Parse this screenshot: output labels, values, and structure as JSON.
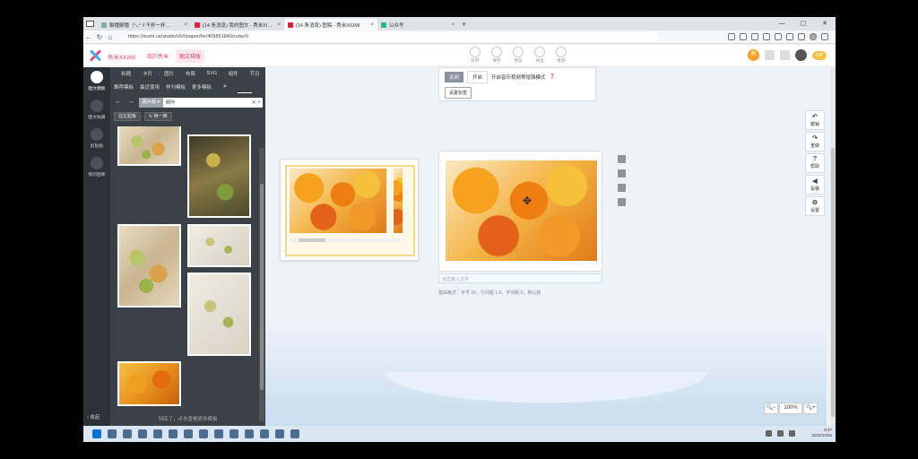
{
  "browser": {
    "tabs": [
      {
        "title": "脚播脚播（°ᴗ°ゞ千杯一杯…",
        "active": false
      },
      {
        "title": "(14 条消息) 我的图文 - 秀米XIU…",
        "active": false
      },
      {
        "title": "(14 条消息) 图稿 - 秀米XIUMI",
        "active": true
      },
      {
        "title": "公众号",
        "active": false
      }
    ],
    "url": "https://xiumi.us/studio/v5#/paper/for/405851840/cube/0"
  },
  "app": {
    "brand": "秀米XIUMI",
    "my_xiumi": "我的秀米",
    "typeset": "图文排版",
    "tools": [
      "打开",
      "保存",
      "预览",
      "导出",
      "更多"
    ],
    "vip": "VIP"
  },
  "rail": {
    "items": [
      "图文模板",
      "图文收藏",
      "剪贴板",
      "我的图库"
    ],
    "collapse": "收起"
  },
  "panel": {
    "tabs": [
      "标题",
      "卡片",
      "图片",
      "布局",
      "SVG",
      "组件",
      "节日"
    ],
    "subtabs": [
      "推荐模板",
      "最近使用",
      "样刊模板",
      "更多模板"
    ],
    "theme_color": "主题色",
    "search_category": "图片组",
    "search_query": "树叶",
    "btn_clipboard": "往左贴板",
    "btn_refresh": "换一换",
    "footer": "到底了，点击查看更多模板"
  },
  "canvas": {
    "toggle_off": "关闭",
    "toggle_on": "开启",
    "toggle_desc": "开启音乐视频等增强模式",
    "set_label": "设置标签",
    "input_placeholder": "点击输入文字",
    "base_format": "基础格式：字号 16，行间距 1.6，字间距 0，默认颜",
    "zoom": "100%"
  },
  "right_tools": [
    {
      "label": "撤销",
      "icon": "undo-icon"
    },
    {
      "label": "重做",
      "icon": "redo-icon"
    },
    {
      "label": "帮助",
      "icon": "help-icon"
    },
    {
      "label": "投稿",
      "icon": "send-icon"
    },
    {
      "label": "设置",
      "icon": "settings-icon"
    }
  ],
  "taskbar": {
    "time": "9:47",
    "date": "2022/10/25"
  }
}
